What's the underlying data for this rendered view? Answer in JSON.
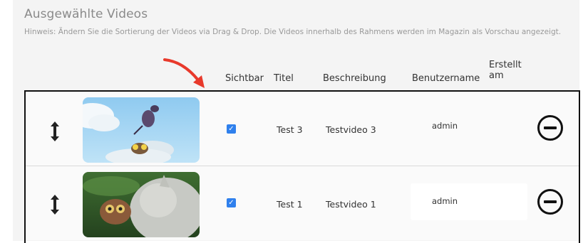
{
  "section": {
    "title": "Ausgewählte Videos",
    "hint": "Hinweis: Ändern Sie die Sortierung der Videos via Drag & Drop. Die Videos innerhalb des Rahmens werden im Magazin als Vorschau angezeigt."
  },
  "columns": {
    "visible": "Sichtbar",
    "title": "Titel",
    "description": "Beschreibung",
    "username": "Benutzername",
    "created_line1": "Erstellt",
    "created_line2": "am"
  },
  "videos": [
    {
      "visible": true,
      "title": "Test 3",
      "description": "Testvideo 3",
      "username": "admin",
      "created": ""
    },
    {
      "visible": true,
      "title": "Test 1",
      "description": "Testvideo 1",
      "username": "admin",
      "created": ""
    }
  ],
  "colors": {
    "accent": "#2f80ed",
    "arrow": "#e8392b",
    "border": "#111111"
  }
}
